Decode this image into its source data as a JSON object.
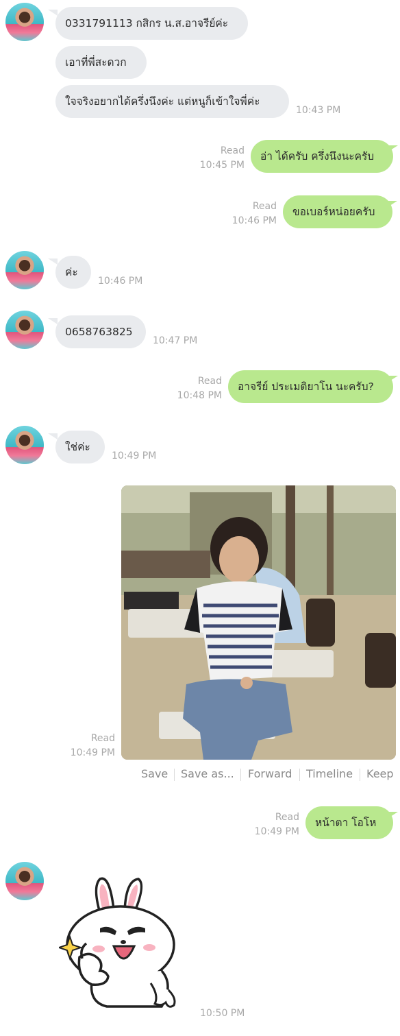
{
  "colors": {
    "incoming_bubble": "#e9ebee",
    "outgoing_bubble": "#b9e88e",
    "meta_text": "#a8a8a8"
  },
  "messages": [
    {
      "side": "in",
      "text": "0331791113 กสิกร น.ส.อาจรีย์ค่ะ"
    },
    {
      "side": "in",
      "text": "เอาที่พี่สะดวก"
    },
    {
      "side": "in",
      "text": "ใจจริงอยากได้ครึ่งนึงค่ะ แต่หนูก็เข้าใจพี่ค่ะ",
      "time": "10:43 PM"
    },
    {
      "side": "out",
      "text": "อ่า ได้ครับ ครึ่งนึงนะครับ",
      "status": "Read",
      "time": "10:45 PM"
    },
    {
      "side": "out",
      "text": "ขอเบอร์หน่อยครับ",
      "status": "Read",
      "time": "10:46 PM"
    },
    {
      "side": "in",
      "text": "ค่ะ",
      "time": "10:46 PM"
    },
    {
      "side": "in",
      "text": "0658763825",
      "time": "10:47 PM"
    },
    {
      "side": "out",
      "text": "อาจรีย์ ประเมติยาโน นะครับ?",
      "status": "Read",
      "time": "10:48 PM"
    },
    {
      "side": "in",
      "text": "ใช่ค่ะ",
      "time": "10:49 PM"
    },
    {
      "side": "out",
      "type": "photo",
      "status": "Read",
      "time": "10:49 PM",
      "actions": [
        "Save",
        "Save as...",
        "Forward",
        "Timeline",
        "Keep"
      ]
    },
    {
      "side": "out",
      "text": "หน้าตา โอโห",
      "status": "Read",
      "time": "10:49 PM"
    },
    {
      "side": "in",
      "type": "sticker",
      "sticker_icon": "cony-rabbit-thumbs-up-sticker",
      "time": "10:50 PM"
    }
  ]
}
